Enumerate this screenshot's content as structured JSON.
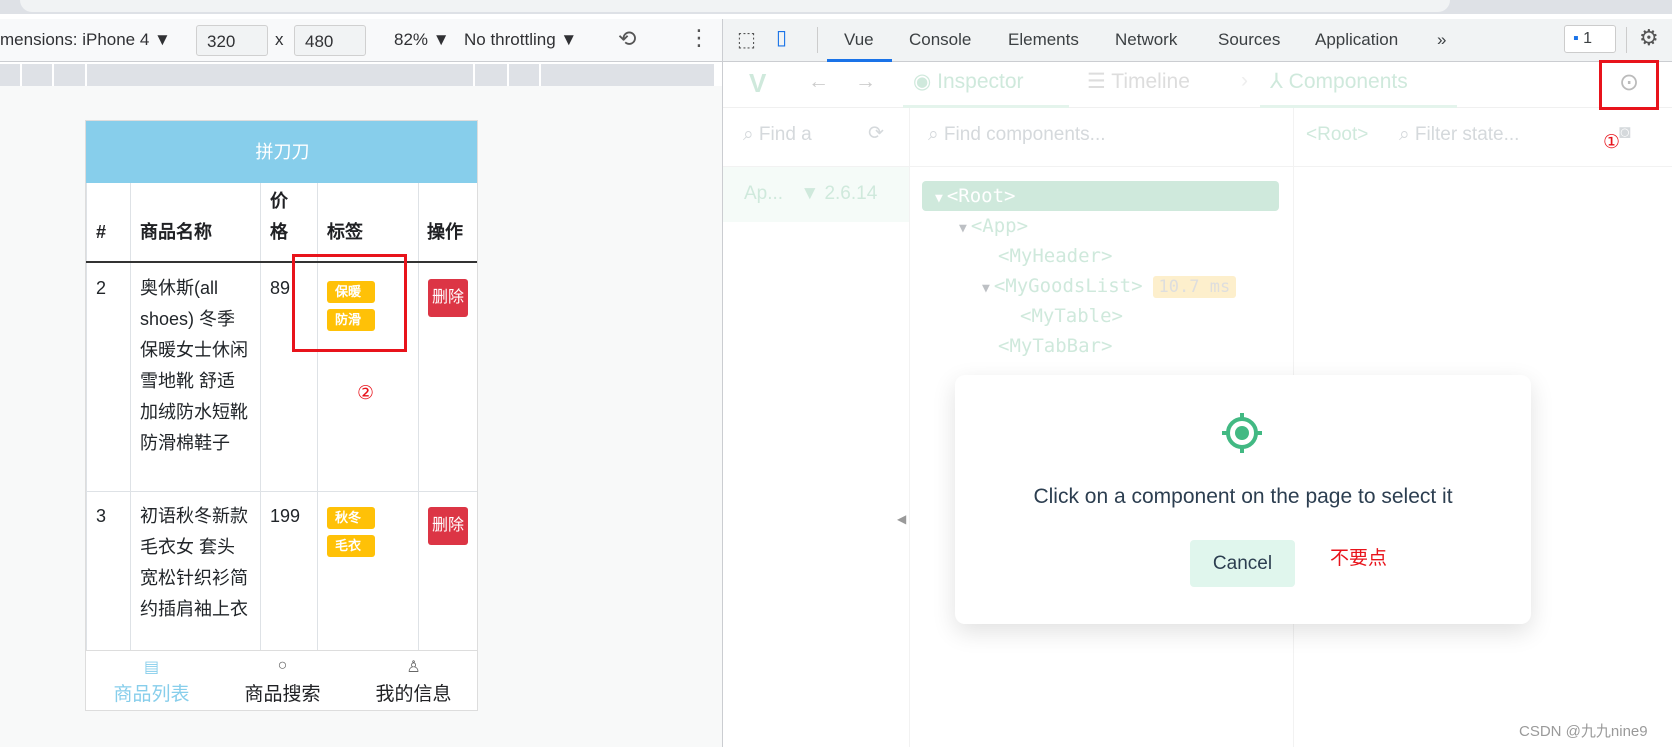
{
  "device_toolbar": {
    "dimensions_label": "mensions: iPhone 4",
    "width": "320",
    "times": "x",
    "height": "480",
    "zoom": "82%",
    "throttling": "No throttling"
  },
  "phone": {
    "header_title": "拼刀刀",
    "columns": [
      "#",
      "商品名称",
      "价\n格",
      "标签",
      "操作"
    ],
    "rows": [
      {
        "id": "2",
        "name": "奥休斯(all shoes) 冬季保暖女士休闲雪地靴 舒适加绒防水短靴 防滑棉鞋子",
        "price": "89",
        "tags": [
          "保暖",
          "防滑"
        ],
        "action": "删除"
      },
      {
        "id": "3",
        "name": "初语秋冬新款毛衣女 套头宽松针织衫简约插肩袖上衣",
        "price": "199",
        "tags": [
          "秋冬",
          "毛衣"
        ],
        "action": "删除"
      }
    ],
    "tabbar": [
      {
        "label": "商品列表",
        "icon": "doc-icon",
        "active": true
      },
      {
        "label": "商品搜索",
        "icon": "search-icon"
      },
      {
        "label": "我的信息",
        "icon": "user-icon"
      }
    ],
    "accent": "#87ceeb"
  },
  "devtools": {
    "tabs": [
      "Vue",
      "Console",
      "Elements",
      "Network",
      "Sources",
      "Application"
    ],
    "more": "»",
    "issues_count": "1",
    "vue_nav": {
      "inspector": "Inspector",
      "timeline": "Timeline",
      "components": "Components"
    },
    "apps_search_placeholder": "Find a",
    "components_search_placeholder": "Find components...",
    "state_target": "<Root>",
    "state_filter_placeholder": "Filter state...",
    "app_name": "Ap...",
    "vue_version": "2.6.14",
    "tree": [
      {
        "label": "<Root>",
        "selected": true,
        "expanded": true
      },
      {
        "label": "<App>",
        "expanded": true
      },
      {
        "label": "<MyHeader>"
      },
      {
        "label": "<MyGoodsList>",
        "expanded": true,
        "badge": "10.7 ms"
      },
      {
        "label": "<MyTable>"
      },
      {
        "label": "<MyTabBar>"
      }
    ],
    "dialog": {
      "message": "Click on a component on the page to select it",
      "cancel": "Cancel"
    },
    "accent": "#42b983"
  },
  "annotations": {
    "one": "①",
    "two": "②",
    "dont_click": "不要点"
  },
  "watermark": "CSDN @九九nine9"
}
